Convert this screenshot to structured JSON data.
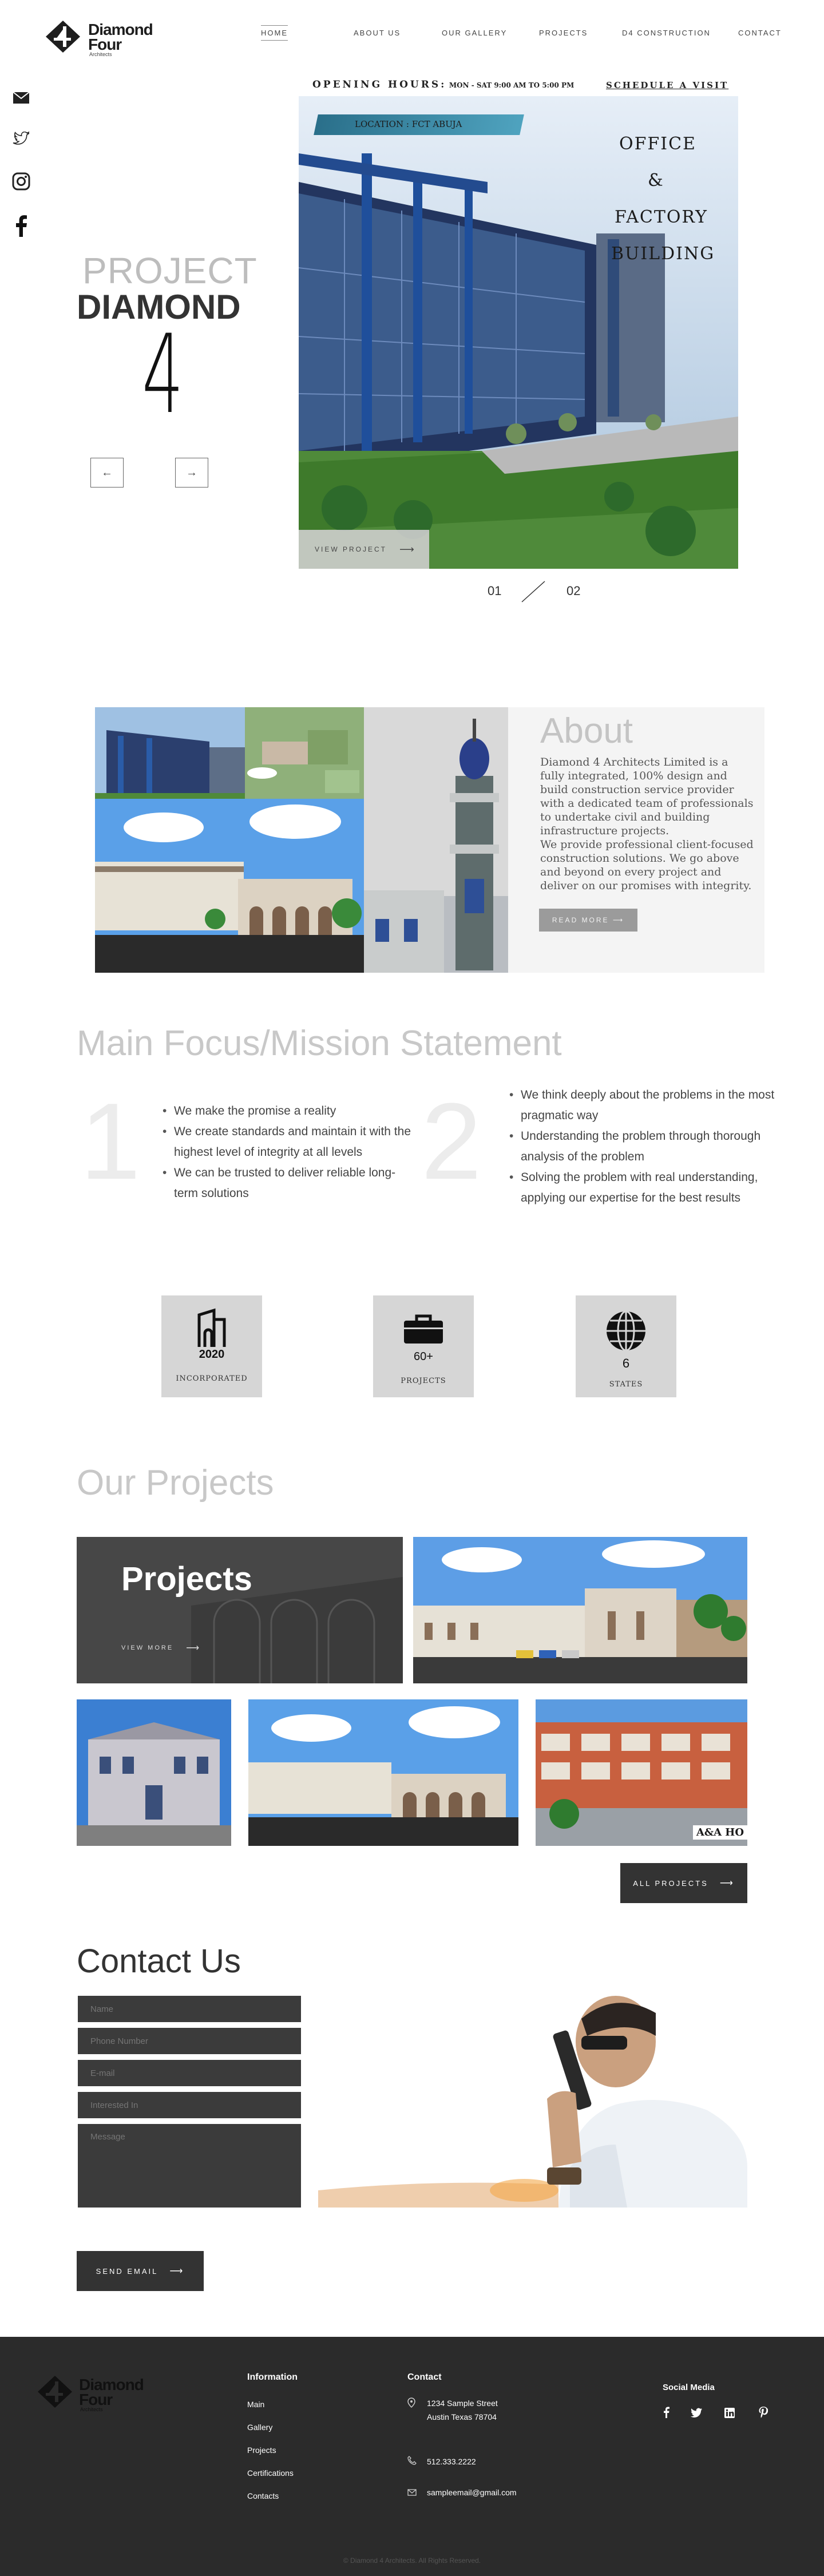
{
  "brand": {
    "name_line1": "Diamond",
    "name_line2": "Four",
    "tagline": "Architects"
  },
  "nav": {
    "items": [
      {
        "label": "HOME"
      },
      {
        "label": "ABOUT US"
      },
      {
        "label": "OUR GALLERY"
      },
      {
        "label": "PROJECTS"
      },
      {
        "label": "D4 CONSTRUCTION"
      },
      {
        "label": "CONTACT"
      }
    ]
  },
  "social_rail": [
    "mail-icon",
    "twitter-icon",
    "instagram-icon",
    "facebook-icon"
  ],
  "hero": {
    "hours_label": "OPENING HOURS:",
    "hours_value": "MON - SAT 9:00 AM TO 5:00 PM",
    "schedule_label": "SCHEDULE A VISIT",
    "project_label": "PROJECT",
    "project_name": "DIAMOND",
    "big_number": "4",
    "prev_arrow": "←",
    "next_arrow": "→",
    "location_banner": "LOCATION : FCT ABUJA",
    "caption_lines": [
      "OFFICE",
      "&",
      "FACTORY",
      "BUILDING"
    ],
    "view_project": "VIEW PROJECT",
    "view_arrow": "⟶",
    "pager_current": "01",
    "pager_total": "02"
  },
  "about": {
    "title": "About",
    "body": "Diamond 4 Architects Limited is a fully integrated, 100% design and build construction service provider with a dedicated team of professionals to undertake civil and building infrastructure projects.",
    "body2": "We provide professional client-focused construction solutions. We go above and beyond on every project and deliver on our promises with integrity.",
    "read_more": "READ MORE ⟶"
  },
  "mission": {
    "title": "Main Focus/Mission Statement",
    "col1_number": "1",
    "col1_items": [
      "We make the promise a reality",
      "We create standards and maintain it with the highest level of integrity at all levels",
      "We can be trusted to deliver reliable long-term solutions"
    ],
    "col2_number": "2",
    "col2_items": [
      "We think deeply about the problems in the most pragmatic way",
      "Understanding the problem through thorough analysis of the problem",
      "Solving the problem with real understanding, applying our expertise for the best results"
    ]
  },
  "stats": [
    {
      "icon": "building-icon",
      "value": "2020",
      "label": "INCORPORATED"
    },
    {
      "icon": "briefcase-icon",
      "value": "60+",
      "label": "PROJECTS"
    },
    {
      "icon": "globe-icon",
      "value": "6",
      "label": "STATES"
    }
  ],
  "projects": {
    "title": "Our Projects",
    "card_title": "Projects",
    "view_more": "VIEW MORE",
    "view_more_arrow": "⟶",
    "sign_text": "A&A HO",
    "all_projects": "ALL PROJECTS",
    "all_arrow": "⟶"
  },
  "contact": {
    "title": "Contact Us",
    "fields": [
      {
        "placeholder": "Name"
      },
      {
        "placeholder": "Phone Number"
      },
      {
        "placeholder": "E-mail"
      },
      {
        "placeholder": "Interested In"
      },
      {
        "placeholder": "Message"
      }
    ],
    "send": "SEND EMAIL",
    "send_arrow": "⟶"
  },
  "footer": {
    "info_title": "Information",
    "info_links": [
      "Main",
      "Gallery",
      "Projects",
      "Certifications",
      "Contacts"
    ],
    "contact_title": "Contact",
    "address_line1": "1234 Sample Street",
    "address_line2": "Austin Texas 78704",
    "phone": "512.333.2222",
    "email": "sampleemail@gmail.com",
    "social_title": "Social Media",
    "social_icons": [
      "facebook-icon",
      "twitter-icon",
      "linkedin-icon",
      "pinterest-icon"
    ],
    "copyright": "© Diamond 4 Architects. All Rights Reserved."
  },
  "colors": {
    "dark": "#333333",
    "footer": "#2b2b2b",
    "stat_box": "#d6d6d6",
    "banner_teal": "#3f8fa8"
  }
}
